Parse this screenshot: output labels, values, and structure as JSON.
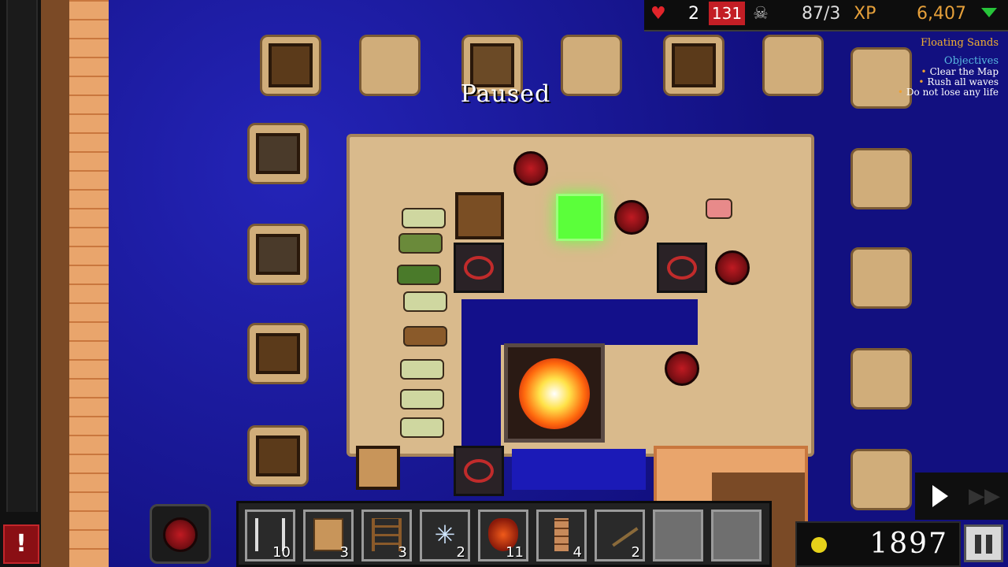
{
  "hud": {
    "lives": "2",
    "wave": "131",
    "kills": "87/3",
    "xp_label": "XP",
    "xp_value": "6,407"
  },
  "level": {
    "title": "Floating Sands",
    "objectives_heading": "Objectives",
    "objectives": [
      "Clear the Map",
      "Rush all waves",
      "Do not lose any life"
    ]
  },
  "status": {
    "paused": "Paused"
  },
  "toolbar": {
    "slots": [
      {
        "name": "arrow-tower",
        "count": "10"
      },
      {
        "name": "crate-wall",
        "count": "3"
      },
      {
        "name": "ladder-trap",
        "count": "3"
      },
      {
        "name": "frost-tower",
        "count": "2"
      },
      {
        "name": "fire-helmet",
        "count": "11"
      },
      {
        "name": "totem",
        "count": "4"
      },
      {
        "name": "crossbow",
        "count": "2"
      },
      {
        "name": "empty",
        "count": ""
      },
      {
        "name": "empty",
        "count": ""
      }
    ]
  },
  "gold": {
    "value": "1897"
  },
  "alert": {
    "symbol": "!"
  },
  "colors": {
    "water": "#121080",
    "sand": "#d9ba8c",
    "accent_red": "#c31e25",
    "xp_gold": "#e6a03a",
    "selection_green": "#5bff3a"
  }
}
